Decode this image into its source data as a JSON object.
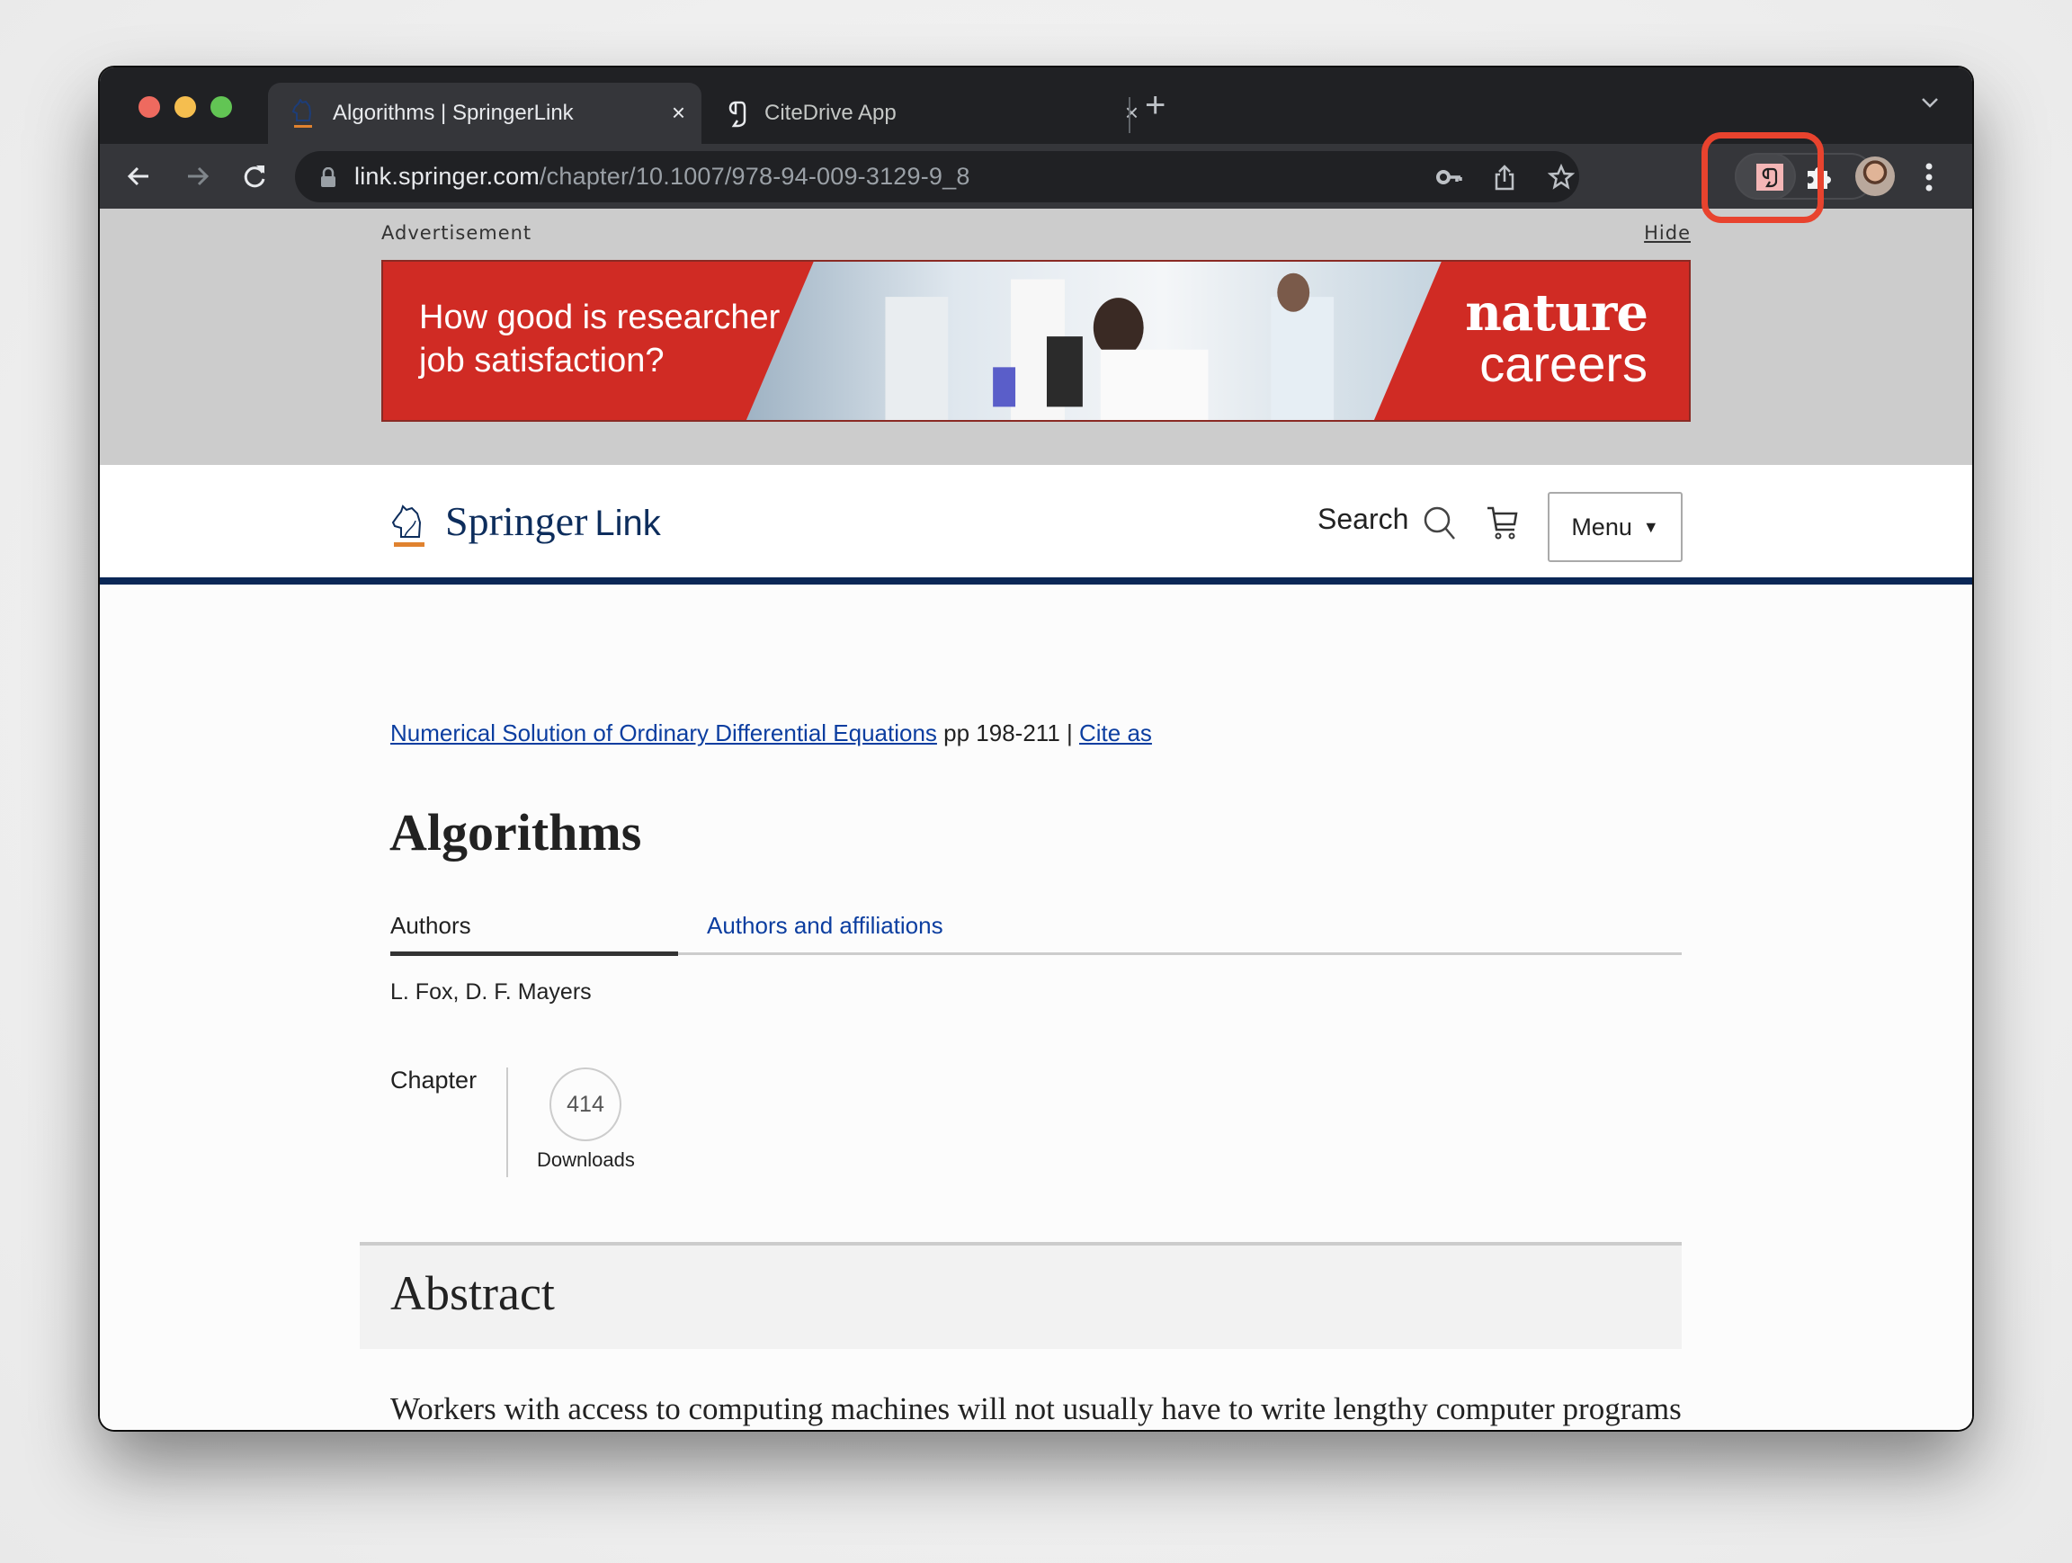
{
  "browser": {
    "tabs": [
      {
        "title": "Algorithms | SpringerLink",
        "close": "×",
        "active": true,
        "favicon": "springer-horse-icon"
      },
      {
        "title": "CiteDrive App",
        "close": "×",
        "active": false,
        "favicon": "citedrive-icon"
      }
    ],
    "new_tab": "+",
    "url_host": "link.springer.com",
    "url_path": "/chapter/10.1007/978-94-009-3129-9_8",
    "colors": {
      "highlight": "#e8432e",
      "citedrive_ext_bg": "#f4b6b6"
    }
  },
  "ad": {
    "label": "Advertisement",
    "hide": "Hide",
    "question_line1": "How good is researcher",
    "question_line2": "job satisfaction?",
    "brand_top": "nature",
    "brand_bottom": "careers",
    "color": "#d02b24"
  },
  "site": {
    "logo_main": "Springer",
    "logo_sub": "Link",
    "search": "Search",
    "menu": "Menu",
    "menu_caret": "▼",
    "brand_color": "#0a2756"
  },
  "article": {
    "book_link": "Numerical Solution of Ordinary Differential Equations",
    "pages": " pp 198-211 | ",
    "cite_as": "Cite as",
    "title": "Algorithms",
    "tabs": [
      "Authors",
      "Authors and affiliations"
    ],
    "authors": "L. Fox, D. F. Mayers",
    "type": "Chapter",
    "downloads_count": "414",
    "downloads_label": "Downloads",
    "abstract_heading": "Abstract",
    "abstract_text": "Workers with access to computing machines will not usually have to write lengthy computer programs making use of the methods described in previous chapters for the solution of"
  }
}
